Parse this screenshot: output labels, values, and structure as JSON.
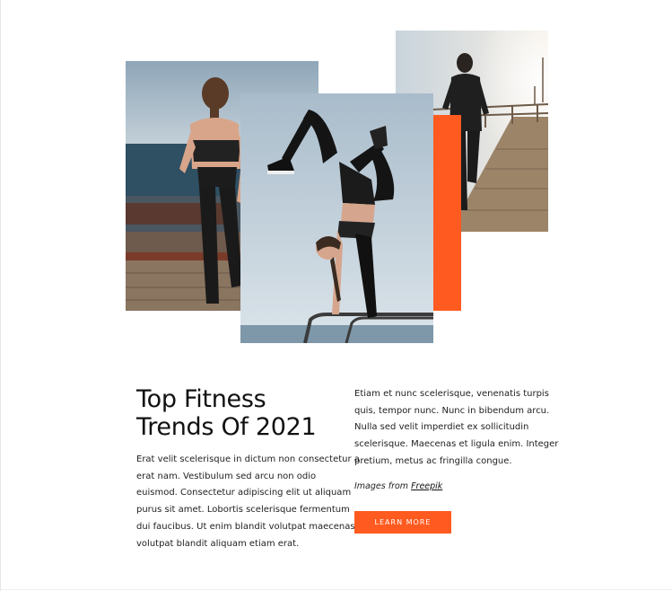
{
  "article": {
    "title_lines": [
      "Top Fitness",
      "Trends Of 2021"
    ],
    "intro_lines": [
      "Erat velit scelerisque in dictum non consectetur a",
      "erat nam. Vestibulum sed arcu non odio",
      "euismod. Consectetur adipiscing elit ut aliquam",
      "purus sit amet. Lobortis scelerisque fermentum",
      "dui faucibus. Ut enim blandit volutpat maecenas",
      "volutpat blandit aliquam etiam erat."
    ],
    "body_lines": [
      "Etiam et nunc scelerisque, venenatis turpis",
      "quis, tempor nunc. Nunc in bibendum arcu.",
      "Nulla sed velit imperdiet ex sollicitudin",
      "scelerisque. Maecenas et ligula enim. Integer",
      "pretium, metus ac fringilla congue."
    ],
    "credit_prefix": "Images from",
    "credit_link": "Freepik",
    "cta_label": "LEARN MORE"
  },
  "colors": {
    "accent": "#ff5a1f",
    "text": "#111111",
    "background": "#ffffff"
  }
}
